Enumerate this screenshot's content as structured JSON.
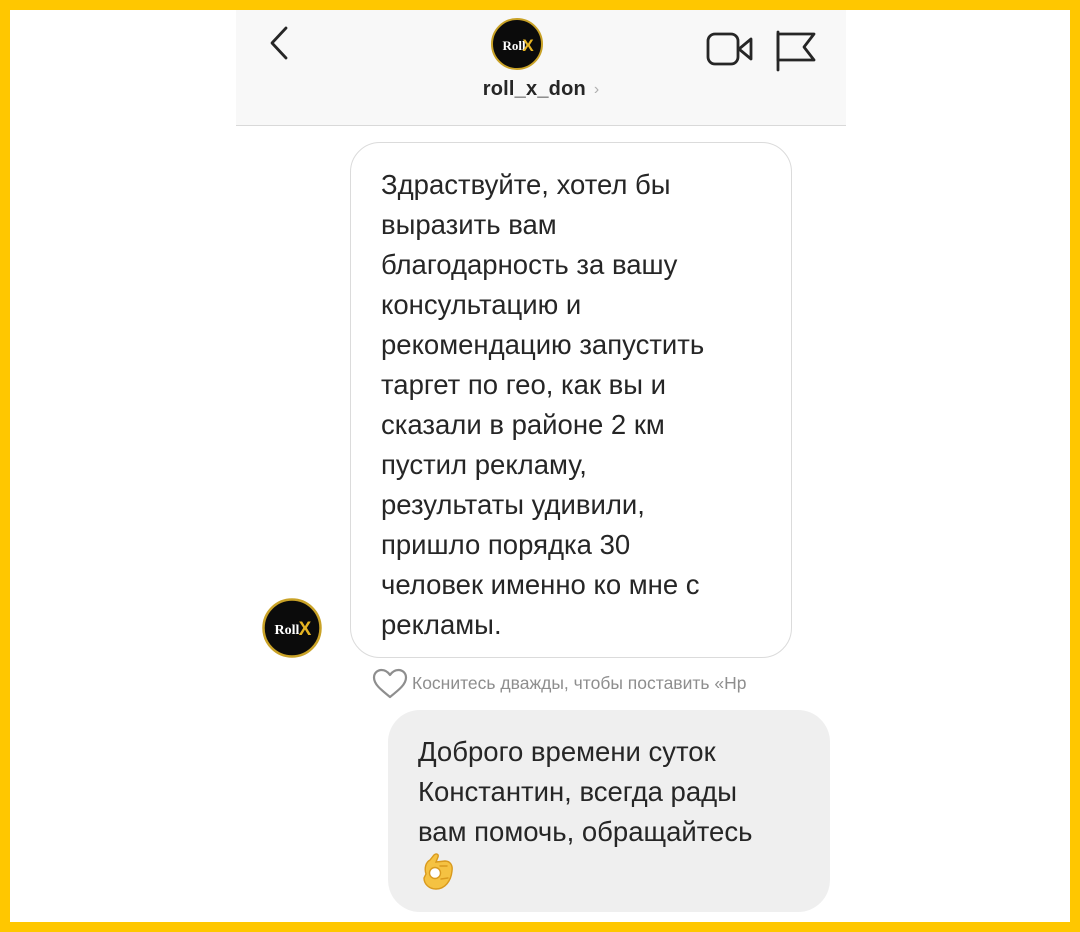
{
  "colors": {
    "frame": "#FFC700",
    "screen_bg": "#FFFFFF",
    "header_bg": "#F8F8F8",
    "incoming_bubble_border": "#DBDBDB",
    "outgoing_bubble_bg": "#EFEFEF",
    "text_primary": "#262626",
    "text_secondary": "#8E8E8E",
    "avatar_bg": "#0B0B0B",
    "avatar_ring": "#C9A227",
    "avatar_x": "#E6B422",
    "emoji": "#F5C242"
  },
  "header": {
    "back_icon": "chevron-left-icon",
    "avatar_logo_text": "Roll",
    "avatar_logo_mark": "X",
    "username": "roll_x_don",
    "username_chevron": "›",
    "video_icon": "video-camera-icon",
    "flag_icon": "flag-icon"
  },
  "messages": [
    {
      "direction": "incoming",
      "text": "Здраствуйте, хотел бы\nвыразить вам\nблагодарность за вашу\nконсультацию и\nрекомендацию запустить\nтаргет по гео, как вы и\nсказали в районе 2 км\nпустил рекламу,\nрезультаты удивили,\nпришло порядка 30\nчеловек именно ко мне с\nрекламы.",
      "sender_avatar_logo_text": "Roll",
      "sender_avatar_logo_mark": "X"
    },
    {
      "direction": "outgoing",
      "text": "Доброго времени суток\nКонстантин, всегда рады\nвам помочь, обращайтесь",
      "emoji": "ok-hand-emoji"
    }
  ],
  "like_hint": {
    "icon": "heart-outline-icon",
    "text": "Коснитесь дважды, чтобы поставить «Нр"
  }
}
